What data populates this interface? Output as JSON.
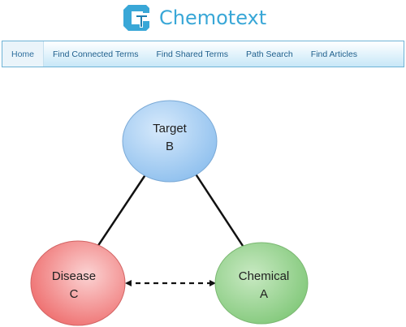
{
  "header": {
    "brand_name": "Chemotext",
    "logo_icon": "chemotext-logo-icon"
  },
  "nav": {
    "items": [
      {
        "label": "Home",
        "active": true
      },
      {
        "label": "Find Connected Terms"
      },
      {
        "label": "Find Shared Terms"
      },
      {
        "label": "Path Search"
      },
      {
        "label": "Find Articles"
      }
    ]
  },
  "diagram": {
    "nodes": {
      "target": {
        "line1": "Target",
        "line2": "B",
        "color": "#a9cff2"
      },
      "disease": {
        "line1": "Disease",
        "line2": "C",
        "color": "#f3a4a4"
      },
      "chemical": {
        "line1": "Chemical",
        "line2": "A",
        "color": "#9fd496"
      }
    },
    "edges": [
      {
        "from": "target",
        "to": "disease",
        "style": "solid"
      },
      {
        "from": "target",
        "to": "chemical",
        "style": "solid"
      },
      {
        "from": "disease",
        "to": "chemical",
        "style": "dashed-bidirectional"
      }
    ]
  },
  "colors": {
    "brand": "#39a7d7",
    "nav_text": "#1f5f8c",
    "nav_border": "#6fb3d6"
  }
}
